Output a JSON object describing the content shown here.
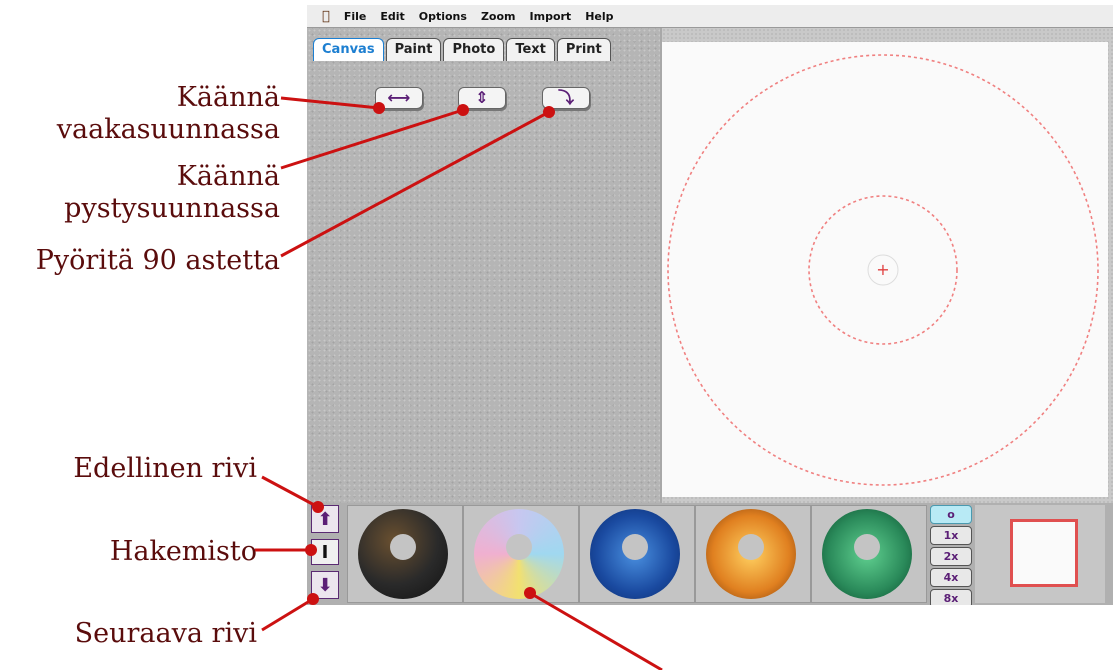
{
  "menu": {
    "apple_icon": "apple-icon",
    "items": [
      "File",
      "Edit",
      "Options",
      "Zoom",
      "Import",
      "Help"
    ]
  },
  "tabs": [
    {
      "label": "Canvas",
      "active": true
    },
    {
      "label": "Paint",
      "active": false
    },
    {
      "label": "Photo",
      "active": false
    },
    {
      "label": "Text",
      "active": false
    },
    {
      "label": "Print",
      "active": false
    }
  ],
  "tool_buttons": {
    "flip_horizontal": "⟷",
    "flip_vertical": "⇕",
    "rotate_90": "⤵"
  },
  "canvas": {
    "guide_color": "#f08080",
    "center_mark": "+"
  },
  "nav": {
    "prev_row": "⬆",
    "index": "I",
    "next_row": "⬇"
  },
  "thumbnails": [
    {
      "name": "music-gold-on-dark",
      "colors": [
        "#2a2a2a",
        "#6a5030"
      ]
    },
    {
      "name": "music-pastel-rainbow",
      "colors": [
        "#c7c7f0",
        "#f2e070"
      ]
    },
    {
      "name": "butterfly-blue",
      "colors": [
        "#2f70c8",
        "#0a2a6a"
      ]
    },
    {
      "name": "butterfly-orange",
      "colors": [
        "#f0a030",
        "#7a3a0a"
      ]
    },
    {
      "name": "butterfly-green",
      "colors": [
        "#3aa870",
        "#0a4a2a"
      ]
    }
  ],
  "zoom": {
    "items": [
      "o",
      "1x",
      "2x",
      "4x",
      "8x"
    ],
    "active_index": 0
  },
  "callouts": {
    "flip_horizontal": [
      "Käännä",
      "vaakasuunnassa"
    ],
    "flip_vertical": [
      "Käännä",
      "pystysuunnassa"
    ],
    "rotate": "Pyöritä 90 astetta",
    "prev_row": "Edellinen rivi",
    "index": "Hakemisto",
    "next_row": "Seuraava rivi"
  },
  "colors": {
    "callout_text": "#5a0c0c",
    "callout_line": "#cc1111",
    "tab_active": "#1d7fd1",
    "button_glyph": "#5b1f76"
  }
}
